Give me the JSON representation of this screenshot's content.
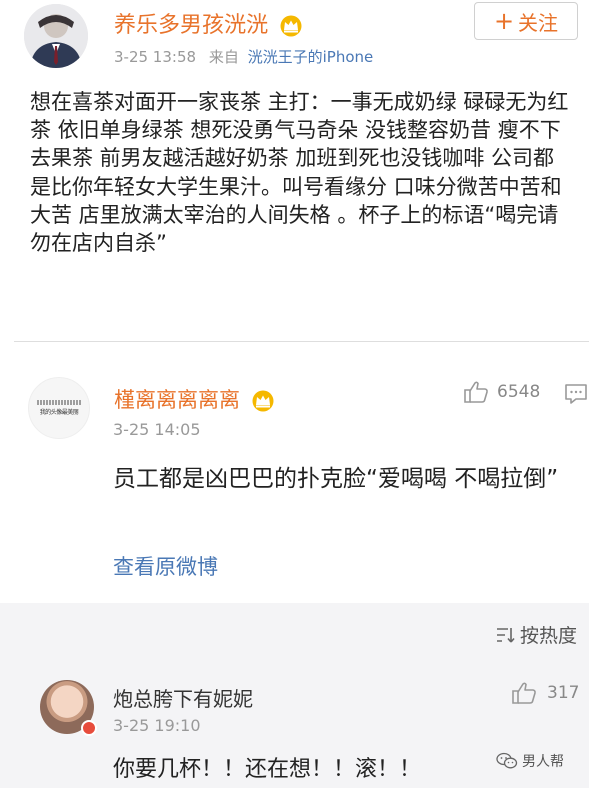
{
  "post": {
    "author_name": "养乐多男孩洸洸",
    "timestamp": "3-25 13:58",
    "from_label": "来自",
    "device": "洸洸王子的iPhone",
    "follow_label": "关注",
    "follow_prefix": "+",
    "body": "想在喜茶对面开一家丧茶 主打：一事无成奶绿 碌碌无为红茶 依旧单身绿茶 想死没勇气马奇朵 没钱整容奶昔 瘦不下去果茶 前男友越活越好奶茶 加班到死也没钱咖啡 公司都是比你年轻女大学生果汁。叫号看缘分 口味分微苦中苦和大苦 店里放满太宰治的人间失格 。杯子上的标语“喝完请勿在店内自杀”"
  },
  "comments": [
    {
      "author_name": "槿离离离离离",
      "avatar_text": "我的头像最美丽",
      "timestamp": "3-25 14:05",
      "likes": "6548",
      "text": "员工都是凶巴巴的扑克脸“爱喝喝 不喝拉倒”",
      "view_origin": "查看原微博"
    }
  ],
  "replies": {
    "sort_label": "按热度",
    "items": [
      {
        "author_name": "炮总胯下有妮妮",
        "timestamp": "3-25 19:10",
        "likes": "317",
        "text": "你要几杯！！还在想！！滚！！"
      }
    ]
  },
  "watermark": "男人帮",
  "colors": {
    "accent_orange": "#e8732b",
    "link_blue": "#4a78b5",
    "meta_gray": "#999999",
    "section_bg": "#f4f4f6",
    "crown_gold": "#f5b800"
  },
  "icons": {
    "crown": "crown-icon",
    "thumb": "thumbs-up-icon",
    "reply": "comment-icon",
    "sort": "sort-icon",
    "watermark_logo": "wechat-logo-icon"
  }
}
